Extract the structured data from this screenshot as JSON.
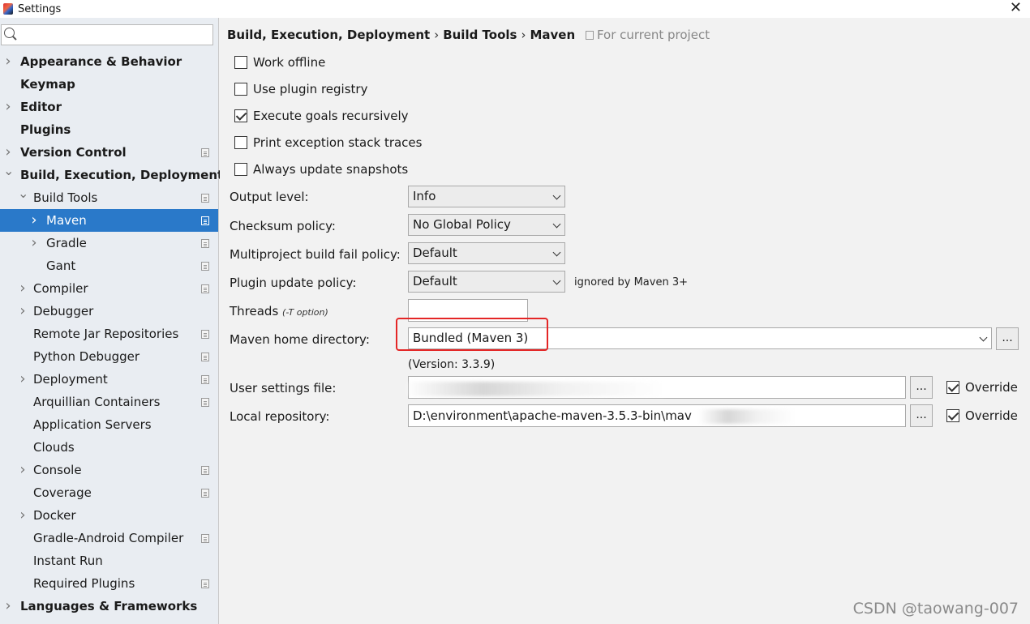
{
  "window": {
    "title": "Settings"
  },
  "search": {
    "placeholder": ""
  },
  "sidebar": {
    "items": [
      {
        "label": "Appearance & Behavior",
        "bold": true,
        "arrow": "right",
        "level": 0,
        "proj": false
      },
      {
        "label": "Keymap",
        "bold": true,
        "arrow": "",
        "level": 0,
        "proj": false
      },
      {
        "label": "Editor",
        "bold": true,
        "arrow": "right",
        "level": 0,
        "proj": false
      },
      {
        "label": "Plugins",
        "bold": true,
        "arrow": "",
        "level": 0,
        "proj": false
      },
      {
        "label": "Version Control",
        "bold": true,
        "arrow": "right",
        "level": 0,
        "proj": true
      },
      {
        "label": "Build, Execution, Deployment",
        "bold": true,
        "arrow": "down",
        "level": 0,
        "proj": false
      },
      {
        "label": "Build Tools",
        "bold": false,
        "arrow": "down",
        "level": 1,
        "proj": true
      },
      {
        "label": "Maven",
        "bold": false,
        "arrow": "right",
        "level": 2,
        "proj": true,
        "selected": true
      },
      {
        "label": "Gradle",
        "bold": false,
        "arrow": "right",
        "level": 2,
        "proj": true
      },
      {
        "label": "Gant",
        "bold": false,
        "arrow": "",
        "level": 2,
        "proj": true
      },
      {
        "label": "Compiler",
        "bold": false,
        "arrow": "right",
        "level": 1,
        "proj": true
      },
      {
        "label": "Debugger",
        "bold": false,
        "arrow": "right",
        "level": 1,
        "proj": false
      },
      {
        "label": "Remote Jar Repositories",
        "bold": false,
        "arrow": "",
        "level": 1,
        "proj": true
      },
      {
        "label": "Python Debugger",
        "bold": false,
        "arrow": "",
        "level": 1,
        "proj": true
      },
      {
        "label": "Deployment",
        "bold": false,
        "arrow": "right",
        "level": 1,
        "proj": true
      },
      {
        "label": "Arquillian Containers",
        "bold": false,
        "arrow": "",
        "level": 1,
        "proj": true
      },
      {
        "label": "Application Servers",
        "bold": false,
        "arrow": "",
        "level": 1,
        "proj": false
      },
      {
        "label": "Clouds",
        "bold": false,
        "arrow": "",
        "level": 1,
        "proj": false
      },
      {
        "label": "Console",
        "bold": false,
        "arrow": "right",
        "level": 1,
        "proj": true
      },
      {
        "label": "Coverage",
        "bold": false,
        "arrow": "",
        "level": 1,
        "proj": true
      },
      {
        "label": "Docker",
        "bold": false,
        "arrow": "right",
        "level": 1,
        "proj": false
      },
      {
        "label": "Gradle-Android Compiler",
        "bold": false,
        "arrow": "",
        "level": 1,
        "proj": true
      },
      {
        "label": "Instant Run",
        "bold": false,
        "arrow": "",
        "level": 1,
        "proj": false
      },
      {
        "label": "Required Plugins",
        "bold": false,
        "arrow": "",
        "level": 1,
        "proj": true
      },
      {
        "label": "Languages & Frameworks",
        "bold": true,
        "arrow": "right",
        "level": 0,
        "proj": false
      }
    ]
  },
  "breadcrumb": {
    "part1": "Build, Execution, Deployment",
    "sep": "›",
    "part2": "Build Tools",
    "part3": "Maven",
    "scope": "For current project"
  },
  "options": {
    "work_offline": {
      "label": "Work offline",
      "checked": false
    },
    "use_plugin_registry": {
      "label": "Use plugin registry",
      "checked": false
    },
    "execute_goals": {
      "label": "Execute goals recursively",
      "checked": true
    },
    "print_exception": {
      "label": "Print exception stack traces",
      "checked": false
    },
    "always_update": {
      "label": "Always update snapshots",
      "checked": false
    }
  },
  "fields": {
    "output_level": {
      "label": "Output level:",
      "value": "Info"
    },
    "checksum_policy": {
      "label": "Checksum policy:",
      "value": "No Global Policy"
    },
    "multiproject_policy": {
      "label": "Multiproject build fail policy:",
      "value": "Default"
    },
    "plugin_update_policy": {
      "label": "Plugin update policy:",
      "value": "Default",
      "note": "ignored by Maven 3+"
    },
    "threads": {
      "label": "Threads",
      "hint": "(-T option)",
      "value": ""
    },
    "maven_home": {
      "label": "Maven home directory:",
      "value": "Bundled (Maven 3)",
      "version": "(Version: 3.3.9)",
      "browse": "..."
    },
    "user_settings": {
      "label": "User settings file:",
      "value": "",
      "browse": "...",
      "override_label": "Override",
      "override_checked": true
    },
    "local_repo": {
      "label": "Local repository:",
      "value": "D:\\environment\\apache-maven-3.5.3-bin\\mav",
      "browse": "...",
      "override_label": "Override",
      "override_checked": true
    }
  },
  "watermark": "CSDN @taowang-007"
}
